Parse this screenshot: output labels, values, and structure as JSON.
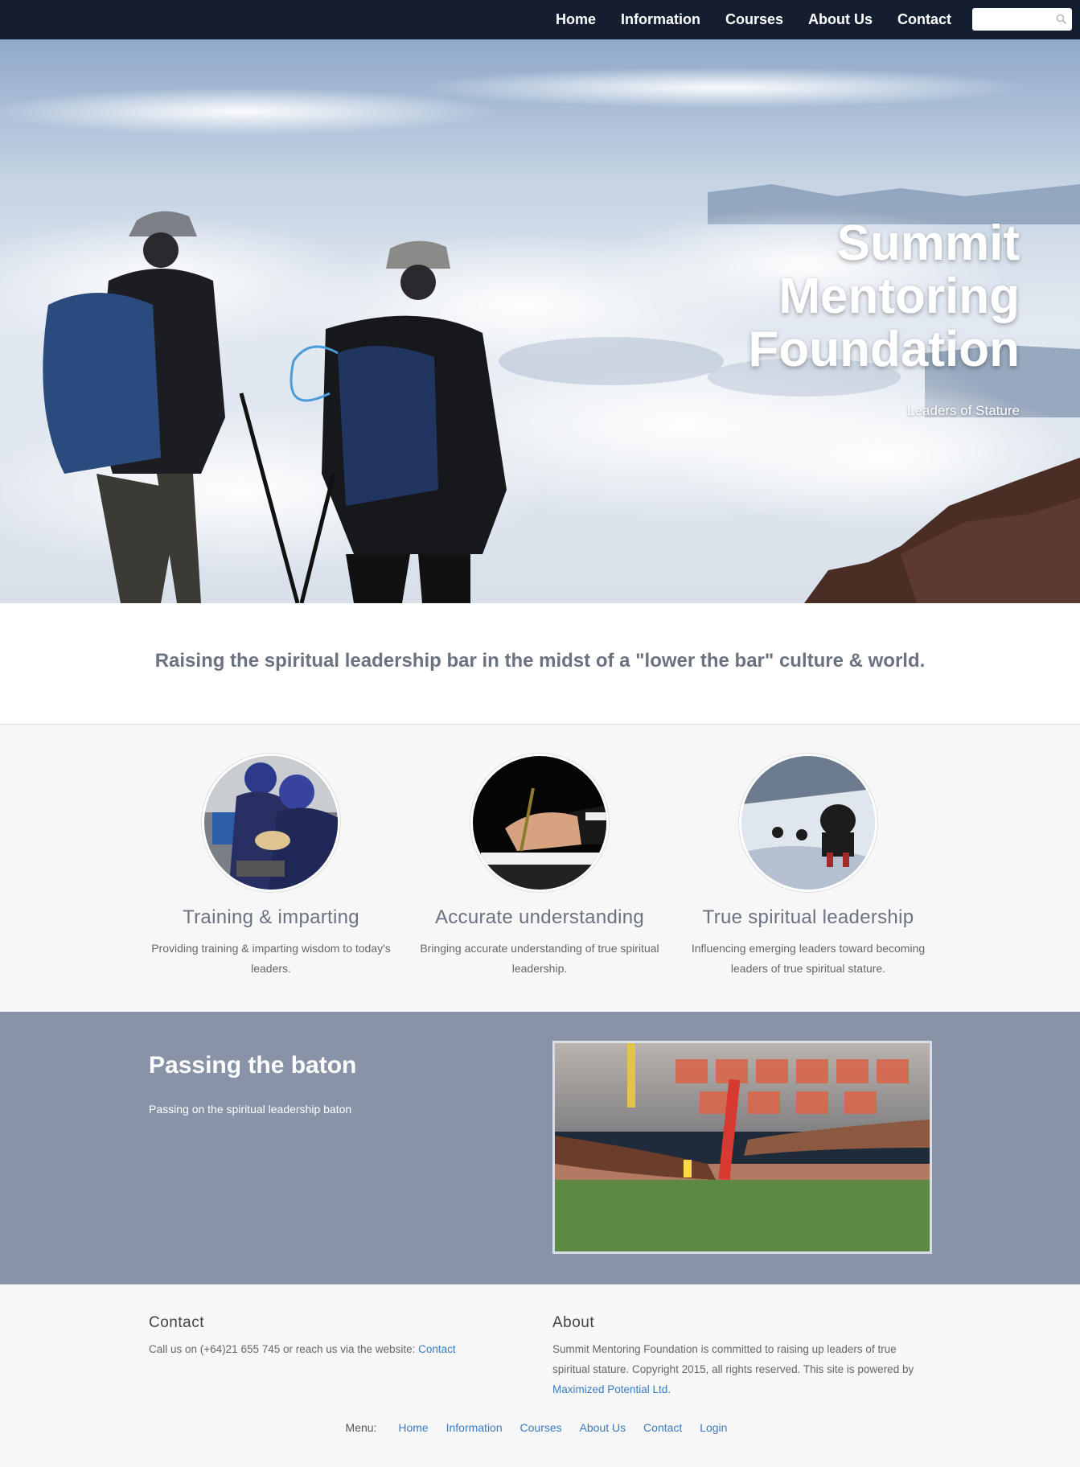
{
  "nav": {
    "items": [
      "Home",
      "Information",
      "Courses",
      "About Us",
      "Contact"
    ],
    "search_placeholder": ""
  },
  "hero": {
    "title": "Summit\nMentoring\nFoundation",
    "subtitle": "Leaders of Stature"
  },
  "tagline": "Raising the spiritual leadership bar in the midst of a \"lower the bar\" culture & world.",
  "features": [
    {
      "title": "Training & imparting",
      "text": "Providing training & imparting wisdom to today's leaders."
    },
    {
      "title": "Accurate understanding",
      "text": "Bringing accurate understanding of true spiritual leadership."
    },
    {
      "title": "True spiritual leadership",
      "text": "Influencing emerging leaders toward becoming leaders of true spiritual stature."
    }
  ],
  "baton": {
    "title": "Passing the baton",
    "text": "Passing on the spiritual leadership baton"
  },
  "footer": {
    "contact_title": "Contact",
    "contact_text": "Call us on (+64)21 655 745 or reach us via the website: ",
    "contact_link": "Contact",
    "about_title": "About",
    "about_text": "Summit Mentoring Foundation is committed to raising up leaders of true spiritual stature. Copyright 2015, all rights reserved. This site is powered by ",
    "about_link": "Maximized Potential Ltd.",
    "menu_label": "Menu:",
    "menu": [
      "Home",
      "Information",
      "Courses",
      "About Us",
      "Contact",
      "Login"
    ]
  },
  "colors": {
    "nav_bg": "#141e30",
    "baton_bg": "#8893a8",
    "link": "#3a7bbf"
  }
}
